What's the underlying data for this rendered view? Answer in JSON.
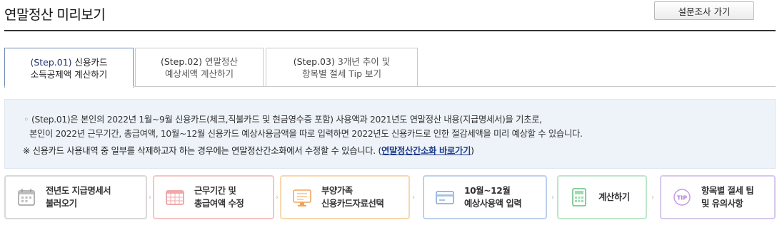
{
  "header": {
    "title": "연말정산 미리보기",
    "survey_button": "설문조사 가기"
  },
  "tabs": [
    {
      "step": "(Step.01)",
      "line1_rest": "신용카드",
      "line2": "소득공제액 계산하기",
      "active": true
    },
    {
      "step": "(Step.02)",
      "line1_rest": "연말정산",
      "line2": "예상세액 계산하기",
      "active": false
    },
    {
      "step": "(Step.03)",
      "line1_rest": "3개년 추이 및",
      "line2": "항목별 절세 Tip 보기",
      "active": false
    }
  ],
  "info": {
    "bullet": "◦",
    "line1": "(Step.01)은 본인의 2022년 1월~9월 신용카드(체크,직불카드 및 현금영수증 포함) 사용액과 2021년도 연말정산 내용(지급명세서)을 기초로,",
    "line2": "본인이 2022년 근무기간, 총급여액, 10월~12월 신용카드 예상사용금액을 따로 입력하면 2022년도 신용카드로 인한 절감세액을 미리 예상할 수 있습니다.",
    "note_prefix": "※ 신용카드 사용내역 중 일부를 삭제하고자 하는 경우에는 연말정산간소화에서 수정할 수 있습니다. (",
    "note_link": "연말정산간소화 바로가기",
    "note_suffix": ")"
  },
  "process_steps": [
    {
      "line1": "전년도 지급명세서",
      "line2": "불러오기",
      "icon": "calendar-icon",
      "color": "#cfcfcf"
    },
    {
      "line1": "근무기간 및",
      "line2": "총급여액 수정",
      "icon": "calendar-grid-icon",
      "color": "#f5c5c5"
    },
    {
      "line1": "부양가족",
      "line2": "신용카드자료선택",
      "icon": "monitor-icon",
      "color": "#f8d7ad"
    },
    {
      "line1": "10월~12월",
      "line2": "예상사용액 입력",
      "icon": "credit-card-icon",
      "color": "#bcd0ec"
    },
    {
      "line1": "계산하기",
      "line2": "",
      "icon": "calculator-icon",
      "color": "#bfe6c9"
    },
    {
      "line1": "항목별 절세 팁",
      "line2": "및 유의사항",
      "icon": "tip-icon",
      "color": "#d8c8ec"
    }
  ],
  "step_arrow": "›"
}
